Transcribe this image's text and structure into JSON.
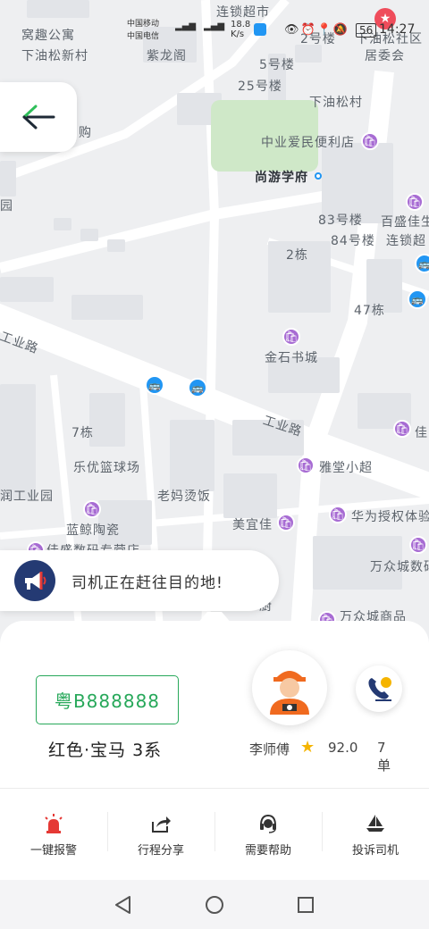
{
  "status_bar": {
    "carrier1": "中国移动",
    "carrier2": "中国电信",
    "net_speed": "18.8",
    "net_unit": "K/s",
    "battery": "56",
    "time": "14:27"
  },
  "map": {
    "labels": {
      "l1": "窝趣公寓",
      "l2": "下油松新村",
      "l3": "连锁超市",
      "l4": "紫龙阁",
      "l5": "2号楼",
      "l6": "下油松社区",
      "l7": "居委会",
      "l8": "5号楼",
      "l9": "25号楼",
      "l10": "下油松村",
      "l11": "购",
      "l12": "中业爱民便利店",
      "l13": "尚游学府",
      "l14": "园",
      "l15": "83号楼",
      "l16": "百盛佳生",
      "l17": "84号楼",
      "l18": "连锁超",
      "l19": "2栋",
      "l20": "47栋",
      "l21": "工业路",
      "l22": "金石书城",
      "l23": "工业路",
      "l24": "7栋",
      "l25": "佳",
      "l26": "乐优篮球场",
      "l27": "雅堂小超",
      "l28": "润工业园",
      "l29": "老妈烫饭",
      "l30": "华为授权体验",
      "l31": "美宜佳",
      "l32": "蓝鲸陶瓷",
      "l33": "佳盛数码专营店",
      "l34": "万众城数码",
      "l35": "万众城商品",
      "l36": "厨"
    }
  },
  "notice": {
    "text": "司机正在赶往目的地!"
  },
  "trip": {
    "plate": "粤B888888",
    "car": "红色·宝马 3系",
    "driver_name": "李师傅",
    "rating": "92.0",
    "orders": "7单"
  },
  "actions": [
    {
      "label": "一键报警",
      "icon": "alarm-icon"
    },
    {
      "label": "行程分享",
      "icon": "share-icon"
    },
    {
      "label": "需要帮助",
      "icon": "headset-icon"
    },
    {
      "label": "投诉司机",
      "icon": "complaint-icon"
    }
  ],
  "colors": {
    "accent_green": "#27a85a",
    "alarm_red": "#e53935",
    "poi_purple": "#a76bd3",
    "bus_blue": "#2196f3"
  }
}
